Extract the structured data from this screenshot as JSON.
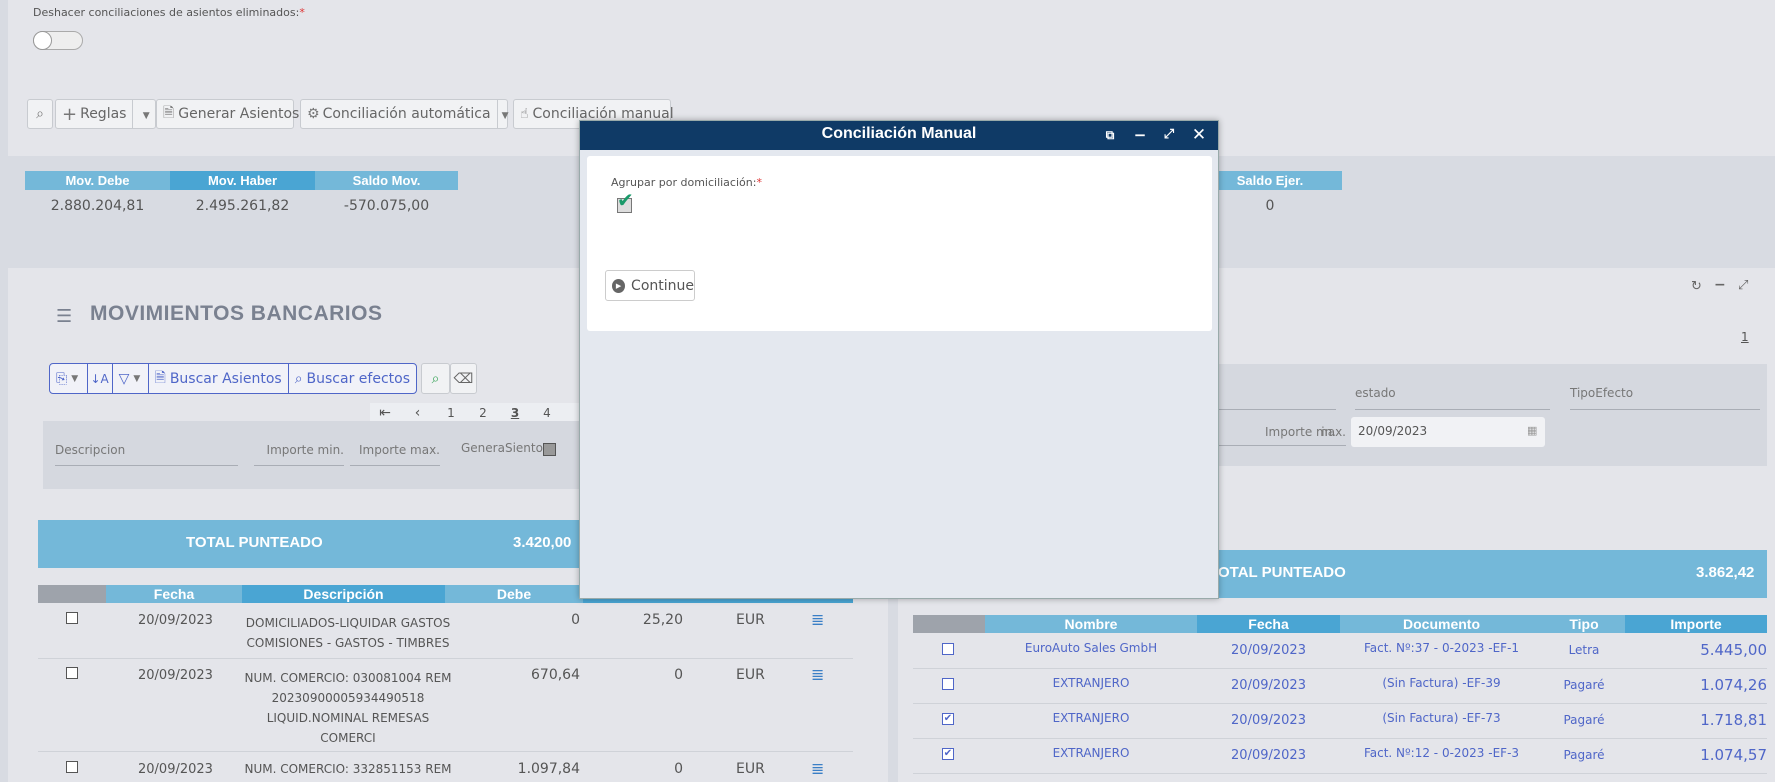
{
  "top": {
    "undo_label": "Deshacer conciliaciones de asientos eliminados:",
    "required_mark": "*",
    "toolbar": {
      "search_icon": "magnifier-icon",
      "rules_label": "Reglas",
      "generate_label": "Generar Asientos",
      "auto_label": "Conciliación automática",
      "manual_label": "Conciliación manual"
    }
  },
  "summary": {
    "headers": [
      "Mov. Debe",
      "Mov. Haber",
      "Saldo Mov."
    ],
    "values": [
      "2.880.204,81",
      "2.495.261,82",
      "-570.075,00"
    ],
    "right_header": "Saldo Ejer.",
    "right_value": "0"
  },
  "left": {
    "title": "MOVIMIENTOS BANCARIOS",
    "btn_buscar_asientos": "Buscar Asientos",
    "btn_buscar_efectos": "Buscar efectos",
    "pager": [
      "1",
      "2",
      "3",
      "4"
    ],
    "filters": {
      "descripcion": "Descripcion",
      "importe_min": "Importe min.",
      "importe_max": "Importe max.",
      "genera_siento": "GeneraSiento"
    },
    "total_label": "TOTAL PUNTEADO",
    "total_value": "3.420,00",
    "columns": [
      "Fecha",
      "Descripción",
      "Debe"
    ],
    "rows": [
      {
        "fecha": "20/09/2023",
        "desc": [
          "DOMICILIADOS-LIQUIDAR GASTOS",
          "COMISIONES - GASTOS - TIMBRES"
        ],
        "debe": "0",
        "haber": "25,20",
        "moneda": "EUR"
      },
      {
        "fecha": "20/09/2023",
        "desc": [
          "NUM. COMERCIO: 030081004 REM",
          "20230900005934490518",
          "LIQUID.NOMINAL REMESAS",
          "COMERCI"
        ],
        "debe": "670,64",
        "haber": "0",
        "moneda": "EUR"
      },
      {
        "fecha": "20/09/2023",
        "desc": [
          "NUM. COMERCIO: 332851153 REM"
        ],
        "debe": "1.097,84",
        "haber": "0",
        "moneda": "EUR"
      }
    ]
  },
  "right": {
    "pager_num": "1",
    "filters": {
      "estado": "estado",
      "tipo_efecto": "TipoEfecto",
      "importe_min_trunc": "in.",
      "importe_max": "Importe max.",
      "date_value": "20/09/2023"
    },
    "total_label": "OTAL PUNTEADO",
    "total_value": "3.862,42",
    "columns": [
      "Nombre",
      "Fecha",
      "Documento",
      "Tipo",
      "Importe"
    ],
    "rows": [
      {
        "checked": false,
        "nombre": "EuroAuto Sales GmbH",
        "fecha": "20/09/2023",
        "doc": "Fact. Nº:37 - 0-2023 -EF-1",
        "tipo": "Letra",
        "importe": "5.445,00"
      },
      {
        "checked": false,
        "nombre": "EXTRANJERO",
        "fecha": "20/09/2023",
        "doc": "(Sin Factura) -EF-39",
        "tipo": "Pagaré",
        "importe": "1.074,26"
      },
      {
        "checked": true,
        "nombre": "EXTRANJERO",
        "fecha": "20/09/2023",
        "doc": "(Sin Factura) -EF-73",
        "tipo": "Pagaré",
        "importe": "1.718,81"
      },
      {
        "checked": true,
        "nombre": "EXTRANJERO",
        "fecha": "20/09/2023",
        "doc": "Fact. Nº:12 - 0-2023 -EF-3",
        "tipo": "Pagaré",
        "importe": "1.074,57"
      }
    ]
  },
  "modal": {
    "title": "Conciliación Manual",
    "field_label": "Agrupar por domiciliación:",
    "required_mark": "*",
    "checkbox_checked": true,
    "continue_label": "Continue"
  },
  "colors": {
    "header_light": "#74b8d9",
    "header_dark": "#4aa5d3",
    "header_grey": "#9ea3ab",
    "modal_title_bar": "#0f3a66",
    "link_blue": "#4f66c8"
  }
}
